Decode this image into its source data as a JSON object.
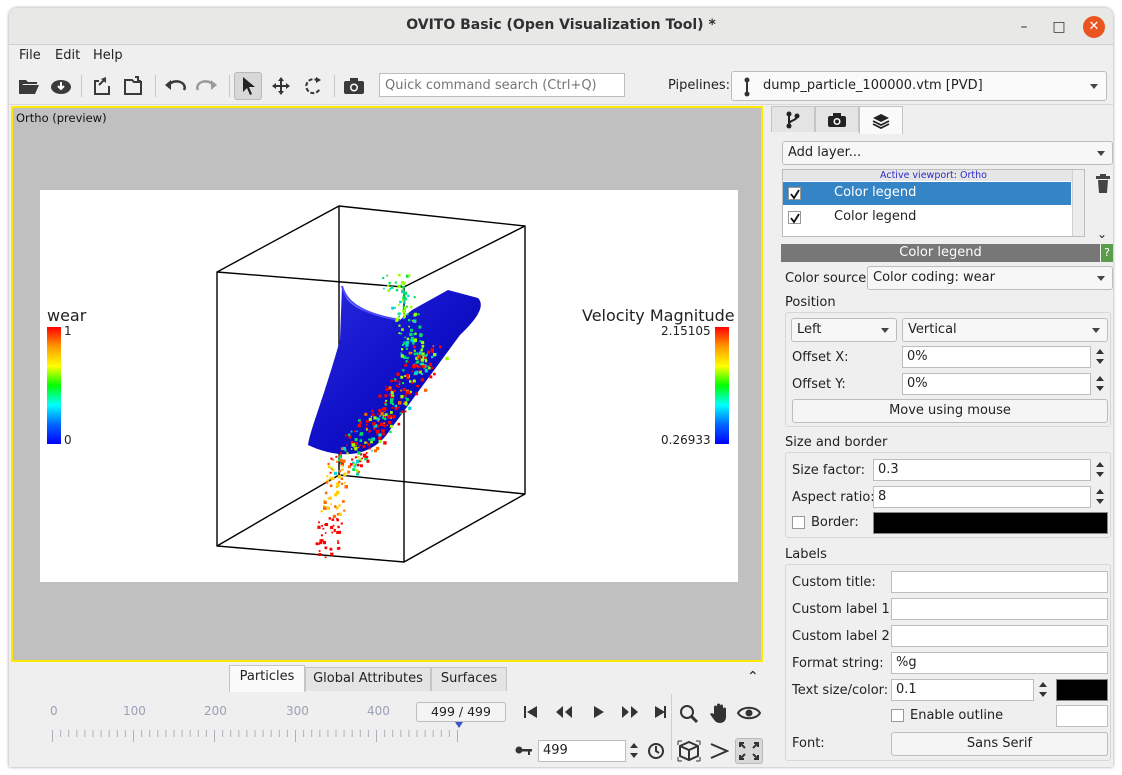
{
  "window": {
    "title": "OVITO Basic (Open Visualization Tool) *"
  },
  "menu": {
    "file": "File",
    "edit": "Edit",
    "help": "Help"
  },
  "toolbar": {
    "search_placeholder": "Quick command search (Ctrl+Q)",
    "pipelines_label": "Pipelines:",
    "pipeline_selected": "dump_particle_100000.vtm [PVD]"
  },
  "viewport": {
    "caption": "Ortho (preview)",
    "legend_left": {
      "title": "wear",
      "max": "1",
      "min": "0"
    },
    "legend_right": {
      "title": "Velocity Magnitude",
      "max": "2.15105",
      "min": "0.26933"
    }
  },
  "bottom_tabs": [
    "Particles",
    "Global Attributes",
    "Surfaces"
  ],
  "timeline": {
    "ticks": [
      "0",
      "100",
      "200",
      "300",
      "400"
    ],
    "frame_display": "499 / 499",
    "frame_value": "499"
  },
  "panel": {
    "add_layer": "Add layer...",
    "active_viewport": "Active viewport: Ortho",
    "layers": [
      {
        "label": "Color legend",
        "checked": true,
        "selected": true
      },
      {
        "label": "Color legend",
        "checked": true,
        "selected": false
      }
    ],
    "section_title": "Color legend",
    "help_label": "?",
    "color_source_label": "Color source:",
    "color_source_value": "Color coding: wear",
    "position_label": "Position",
    "alignment_value": "Left",
    "orientation_value": "Vertical",
    "offset_x_label": "Offset X:",
    "offset_x_value": "0%",
    "offset_y_label": "Offset Y:",
    "offset_y_value": "0%",
    "move_button": "Move using mouse",
    "size_border_label": "Size and border",
    "size_factor_label": "Size factor:",
    "size_factor_value": "0.3",
    "aspect_ratio_label": "Aspect ratio:",
    "aspect_ratio_value": "8",
    "border_label": "Border:",
    "labels_label": "Labels",
    "custom_title_label": "Custom title:",
    "custom_label1_label": "Custom label 1:",
    "custom_label2_label": "Custom label 2:",
    "format_string_label": "Format string:",
    "format_string_value": "%g",
    "text_size_label": "Text size/color:",
    "text_size_value": "0.1",
    "enable_outline_label": "Enable outline",
    "font_label": "Font:",
    "font_button": "Sans Serif"
  },
  "colors": {
    "accent": "#3584c5",
    "viewport_border": "#ffe900",
    "close": "#e95420"
  }
}
